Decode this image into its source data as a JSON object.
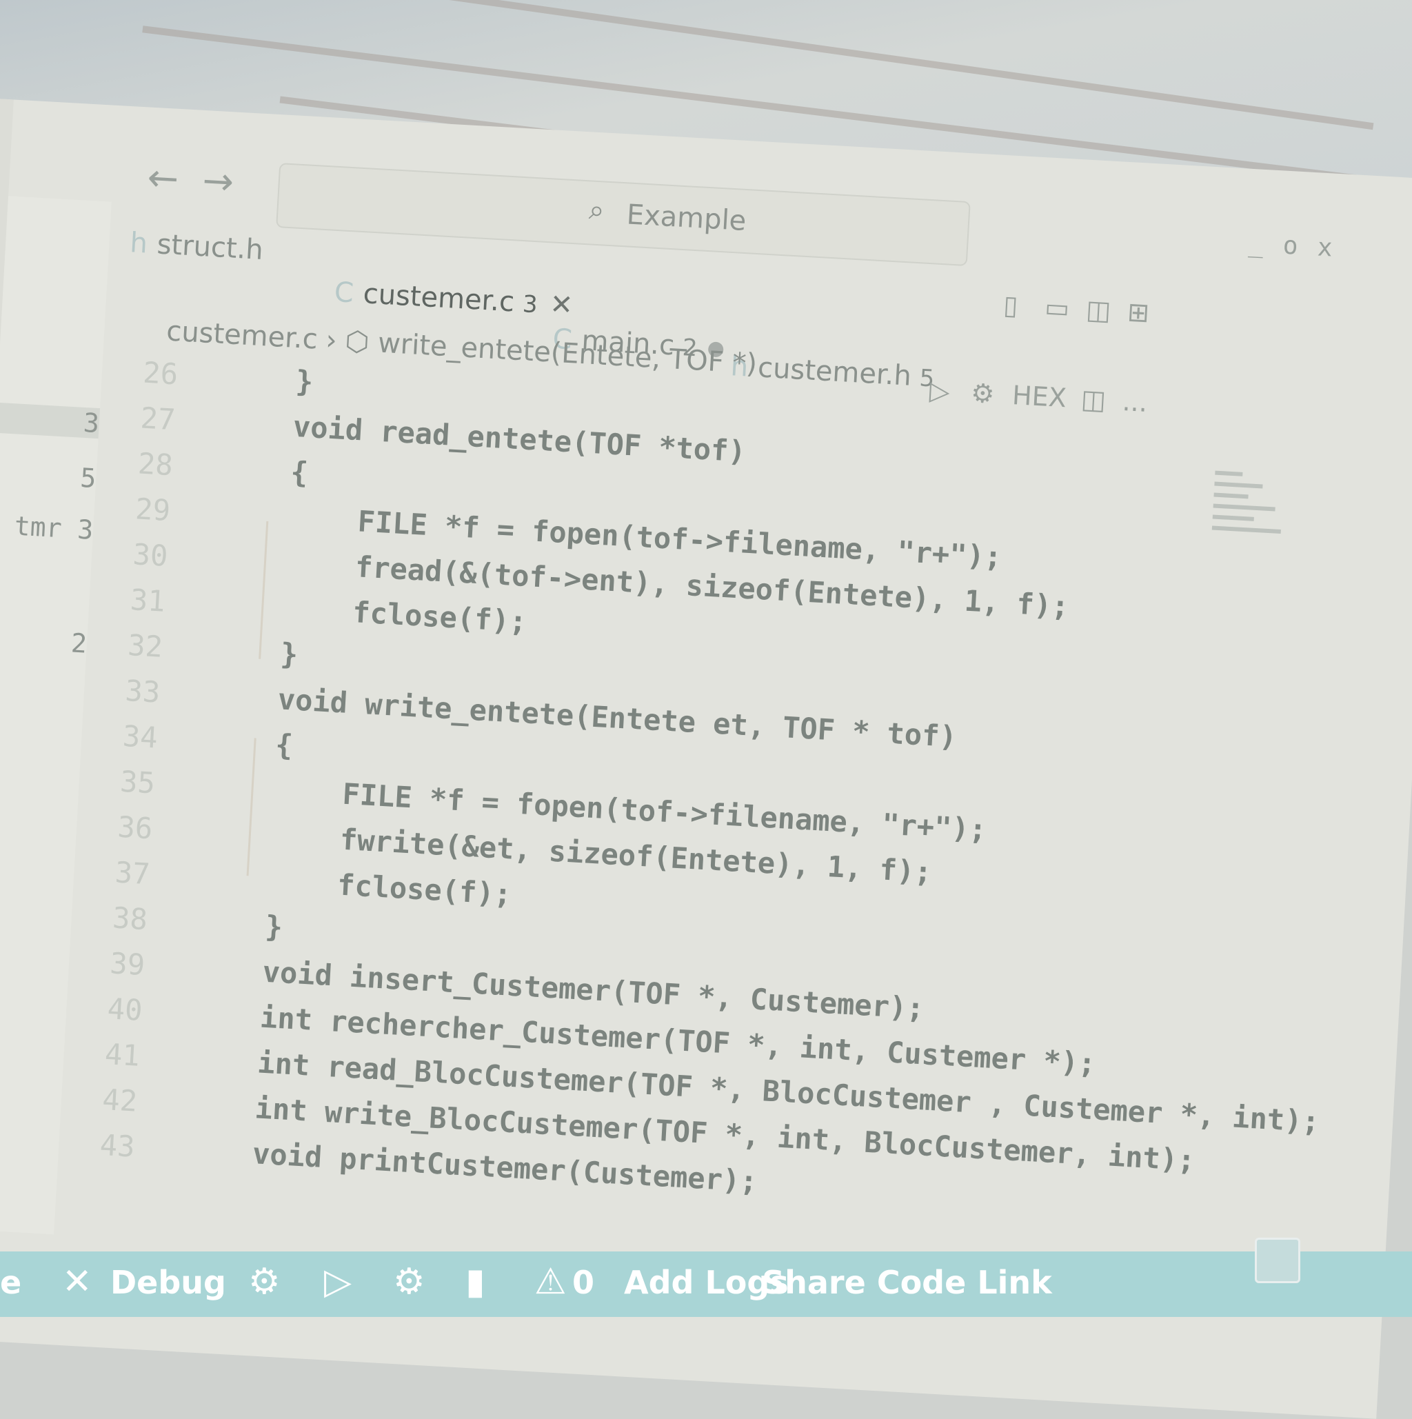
{
  "titlebar": {
    "more_menu": "...",
    "back_arrow": "←",
    "forward_arrow": "→",
    "search_placeholder": "Example",
    "window_buttons": [
      "_",
      "o",
      "x"
    ]
  },
  "sidebar": {
    "more_menu": "...",
    "counters": [
      "3",
      "5",
      "tmr 3",
      "2"
    ]
  },
  "tabs": [
    {
      "label": "struct.h",
      "badge": "",
      "state": ""
    },
    {
      "label": "custemer.c",
      "badge": "3",
      "state": "active"
    },
    {
      "label": "main.c",
      "badge": "2",
      "state": "modified"
    },
    {
      "label": "custemer.h",
      "badge": "5",
      "state": ""
    }
  ],
  "toolbar": {
    "hex_label": "HEX",
    "more": "..."
  },
  "breadcrumb": {
    "file": "custemer.c",
    "symbol": "write_entete(Entete, TOF *)"
  },
  "editor": {
    "lines": [
      {
        "num": "26",
        "text": "    }"
      },
      {
        "num": "27",
        "text": "    void read_entete(TOF *tof)"
      },
      {
        "num": "28",
        "text": "    {"
      },
      {
        "num": "29",
        "text": "        FILE *f = fopen(tof->filename, \"r+\");"
      },
      {
        "num": "30",
        "text": "        fread(&(tof->ent), sizeof(Entete), 1, f);"
      },
      {
        "num": "31",
        "text": "        fclose(f);"
      },
      {
        "num": "32",
        "text": "    }"
      },
      {
        "num": "33",
        "text": "    void write_entete(Entete et, TOF * tof)"
      },
      {
        "num": "34",
        "text": "    {"
      },
      {
        "num": "35",
        "text": "        FILE *f = fopen(tof->filename, \"r+\");"
      },
      {
        "num": "36",
        "text": "        fwrite(&et, sizeof(Entete), 1, f);"
      },
      {
        "num": "37",
        "text": "        fclose(f);"
      },
      {
        "num": "38",
        "text": "    }"
      },
      {
        "num": "39",
        "text": "    void insert_Custemer(TOF *, Custemer);"
      },
      {
        "num": "40",
        "text": "    int rechercher_Custemer(TOF *, int, Custemer *);"
      },
      {
        "num": "41",
        "text": "    int read_BlocCustemer(TOF *, BlocCustemer , Custemer *, int);"
      },
      {
        "num": "42",
        "text": "    int write_BlocCustemer(TOF *, int, BlocCustemer, int);"
      },
      {
        "num": "43",
        "text": "    void printCustemer(Custemer);"
      }
    ]
  },
  "statusbar": {
    "left_fragment": "e",
    "debug_label": "Debug",
    "warnings_count": "0",
    "add_logs": "Add Logs",
    "share_code_link": "Share Code Link"
  },
  "colors": {
    "statusbar": "#a9d5d6",
    "code_text": "#7c847f",
    "line_numbers": "#c7cbc5",
    "background": "#e2e3dd"
  }
}
